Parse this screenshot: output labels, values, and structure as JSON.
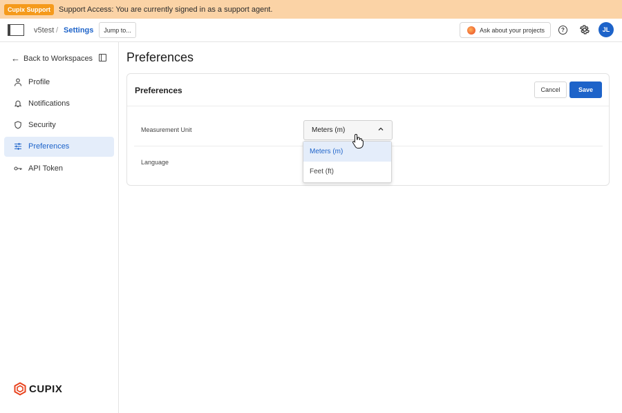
{
  "banner": {
    "badge": "Cupix Support",
    "message": "Support Access: You are currently signed in as a support agent."
  },
  "topbar": {
    "workspace": "v5test",
    "separator": "/",
    "current": "Settings",
    "jump_label": "Jump to...",
    "ask_label": "Ask about your projects",
    "avatar_initials": "JL"
  },
  "sidebar": {
    "back_label": "Back to Workspaces",
    "items": [
      {
        "label": "Profile",
        "icon": "person-icon"
      },
      {
        "label": "Notifications",
        "icon": "bell-icon"
      },
      {
        "label": "Security",
        "icon": "shield-icon"
      },
      {
        "label": "Preferences",
        "icon": "sliders-icon",
        "active": true
      },
      {
        "label": "API Token",
        "icon": "key-icon"
      }
    ],
    "logo_text": "CUPIX"
  },
  "main": {
    "page_title": "Preferences",
    "card_title": "Preferences",
    "cancel_label": "Cancel",
    "save_label": "Save",
    "measurement_label": "Measurement Unit",
    "language_label": "Language",
    "measurement_value": "Meters (m)",
    "options": [
      "Meters (m)",
      "Feet (ft)"
    ]
  },
  "colors": {
    "accent": "#1d63c9",
    "banner_bg": "#fbd3a6",
    "badge_bg": "#f59a1b",
    "active_bg": "#e4edfa"
  }
}
